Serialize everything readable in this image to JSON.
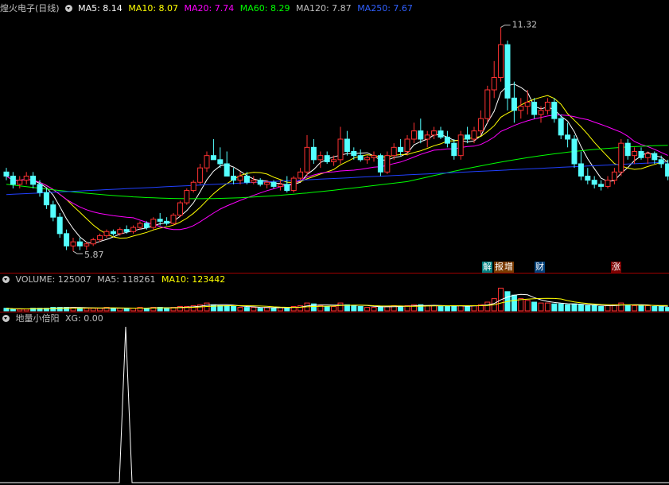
{
  "price_panel": {
    "title": "煌火电子(日线)",
    "legends": [
      {
        "label": "MA5: 8.14",
        "color": "#ffffff"
      },
      {
        "label": "MA10: 8.07",
        "color": "#ffff00"
      },
      {
        "label": "MA20: 7.74",
        "color": "#ff00ff"
      },
      {
        "label": "MA60: 8.29",
        "color": "#00ff00"
      },
      {
        "label": "MA120: 7.87",
        "color": "#c0c0c0"
      },
      {
        "label": "MA250: 7.67",
        "color": "#0000ff"
      }
    ],
    "high_label": "11.32",
    "low_label": "5.87",
    "events": [
      {
        "text": "解",
        "bg": "#00a0a0",
        "color": "#ffffff"
      },
      {
        "text": "报",
        "bg": "#a05000",
        "color": "#ffffff"
      },
      {
        "text": "增",
        "bg": "#a05000",
        "color": "#ffffff"
      },
      {
        "text": "财",
        "bg": "#0050a0",
        "color": "#ffffff"
      },
      {
        "text": "涨",
        "bg": "#a00000",
        "color": "#ffffff"
      }
    ]
  },
  "volume_panel": {
    "legends": [
      {
        "label": "VOLUME: 125007",
        "color": "#c0c0c0"
      },
      {
        "label": "MA5: 118261",
        "color": "#c0c0c0"
      },
      {
        "label": "MA10: 123442",
        "color": "#ffff00"
      }
    ]
  },
  "indicator_panel": {
    "legends": [
      {
        "label": "地量小倍阳",
        "color": "#c0c0c0"
      },
      {
        "label": "XG: 0.00",
        "color": "#c0c0c0"
      }
    ]
  },
  "chart_data": {
    "type": "candlestick",
    "candles": [
      [
        7.8,
        7.9,
        7.6,
        7.7
      ],
      [
        7.7,
        7.8,
        7.4,
        7.5
      ],
      [
        7.5,
        7.7,
        7.4,
        7.6
      ],
      [
        7.6,
        7.8,
        7.5,
        7.7
      ],
      [
        7.7,
        7.8,
        7.4,
        7.5
      ],
      [
        7.5,
        7.6,
        7.2,
        7.3
      ],
      [
        7.3,
        7.4,
        6.9,
        7.0
      ],
      [
        7.0,
        7.1,
        6.6,
        6.7
      ],
      [
        6.7,
        6.8,
        6.2,
        6.3
      ],
      [
        6.3,
        6.4,
        5.9,
        6.0
      ],
      [
        6.0,
        6.2,
        5.87,
        6.1
      ],
      [
        6.1,
        6.2,
        5.9,
        6.0
      ],
      [
        6.0,
        6.1,
        5.9,
        6.05
      ],
      [
        6.05,
        6.2,
        6.0,
        6.15
      ],
      [
        6.15,
        6.3,
        6.1,
        6.25
      ],
      [
        6.25,
        6.4,
        6.2,
        6.35
      ],
      [
        6.35,
        6.4,
        6.25,
        6.3
      ],
      [
        6.3,
        6.45,
        6.25,
        6.4
      ],
      [
        6.4,
        6.5,
        6.3,
        6.35
      ],
      [
        6.35,
        6.5,
        6.3,
        6.45
      ],
      [
        6.45,
        6.6,
        6.4,
        6.55
      ],
      [
        6.55,
        6.6,
        6.4,
        6.45
      ],
      [
        6.45,
        6.7,
        6.4,
        6.65
      ],
      [
        6.65,
        6.8,
        6.5,
        6.6
      ],
      [
        6.6,
        6.7,
        6.5,
        6.55
      ],
      [
        6.55,
        6.8,
        6.5,
        6.75
      ],
      [
        6.75,
        7.1,
        6.7,
        7.05
      ],
      [
        7.05,
        7.4,
        7.0,
        7.35
      ],
      [
        7.35,
        7.6,
        7.3,
        7.55
      ],
      [
        7.55,
        8.0,
        7.5,
        7.9
      ],
      [
        7.9,
        8.3,
        7.8,
        8.2
      ],
      [
        8.2,
        8.6,
        8.1,
        8.1
      ],
      [
        8.1,
        8.4,
        7.9,
        8.0
      ],
      [
        8.0,
        8.3,
        7.8,
        7.7
      ],
      [
        7.7,
        7.9,
        7.5,
        7.6
      ],
      [
        7.6,
        7.8,
        7.5,
        7.7
      ],
      [
        7.7,
        7.8,
        7.5,
        7.55
      ],
      [
        7.55,
        7.7,
        7.5,
        7.6
      ],
      [
        7.6,
        7.65,
        7.45,
        7.5
      ],
      [
        7.5,
        7.6,
        7.4,
        7.55
      ],
      [
        7.55,
        7.6,
        7.4,
        7.45
      ],
      [
        7.45,
        7.6,
        7.35,
        7.5
      ],
      [
        7.5,
        7.7,
        7.3,
        7.35
      ],
      [
        7.35,
        7.7,
        7.3,
        7.65
      ],
      [
        7.65,
        7.9,
        7.6,
        7.8
      ],
      [
        7.8,
        8.7,
        7.7,
        8.4
      ],
      [
        8.4,
        8.6,
        8.0,
        8.1
      ],
      [
        8.1,
        8.3,
        7.9,
        8.2
      ],
      [
        8.2,
        8.3,
        8.0,
        8.05
      ],
      [
        8.05,
        8.2,
        7.95,
        8.1
      ],
      [
        8.1,
        8.9,
        8.0,
        8.6
      ],
      [
        8.6,
        8.8,
        8.2,
        8.3
      ],
      [
        8.3,
        8.4,
        8.1,
        8.2
      ],
      [
        8.2,
        8.35,
        8.05,
        8.1
      ],
      [
        8.1,
        8.2,
        8.0,
        8.15
      ],
      [
        8.15,
        8.3,
        8.05,
        8.2
      ],
      [
        8.2,
        8.25,
        7.7,
        7.8
      ],
      [
        7.8,
        8.3,
        7.75,
        8.2
      ],
      [
        8.2,
        8.5,
        8.1,
        8.4
      ],
      [
        8.4,
        8.6,
        8.2,
        8.3
      ],
      [
        8.3,
        8.7,
        8.2,
        8.6
      ],
      [
        8.6,
        9.0,
        8.5,
        8.8
      ],
      [
        8.8,
        9.1,
        8.5,
        8.6
      ],
      [
        8.6,
        8.8,
        8.4,
        8.7
      ],
      [
        8.7,
        8.9,
        8.6,
        8.8
      ],
      [
        8.8,
        8.9,
        8.6,
        8.65
      ],
      [
        8.65,
        8.8,
        8.4,
        8.5
      ],
      [
        8.5,
        8.6,
        8.1,
        8.2
      ],
      [
        8.2,
        8.8,
        8.1,
        8.7
      ],
      [
        8.7,
        8.9,
        8.5,
        8.6
      ],
      [
        8.6,
        8.9,
        8.5,
        8.8
      ],
      [
        8.8,
        9.3,
        8.7,
        9.1
      ],
      [
        9.1,
        9.9,
        9.0,
        9.8
      ],
      [
        9.8,
        10.5,
        9.6,
        10.1
      ],
      [
        10.1,
        11.32,
        10.0,
        10.9
      ],
      [
        10.9,
        11.0,
        9.3,
        9.6
      ],
      [
        9.6,
        10.0,
        9.0,
        9.3
      ],
      [
        9.3,
        9.6,
        9.1,
        9.4
      ],
      [
        9.4,
        9.8,
        9.2,
        9.5
      ],
      [
        9.5,
        9.6,
        9.1,
        9.2
      ],
      [
        9.2,
        9.4,
        9.0,
        9.3
      ],
      [
        9.3,
        9.6,
        9.2,
        9.5
      ],
      [
        9.5,
        9.6,
        9.0,
        9.1
      ],
      [
        9.1,
        9.2,
        8.6,
        8.7
      ],
      [
        8.7,
        9.0,
        8.4,
        8.6
      ],
      [
        8.6,
        8.7,
        7.9,
        8.0
      ],
      [
        8.0,
        8.3,
        7.6,
        7.7
      ],
      [
        7.7,
        7.9,
        7.5,
        7.6
      ],
      [
        7.6,
        7.7,
        7.4,
        7.5
      ],
      [
        7.5,
        7.6,
        7.35,
        7.45
      ],
      [
        7.45,
        7.7,
        7.4,
        7.6
      ],
      [
        7.6,
        7.9,
        7.5,
        7.8
      ],
      [
        7.8,
        8.6,
        7.7,
        8.5
      ],
      [
        8.5,
        8.6,
        8.1,
        8.2
      ],
      [
        8.2,
        8.4,
        8.0,
        8.3
      ],
      [
        8.3,
        8.4,
        8.1,
        8.15
      ],
      [
        8.15,
        8.3,
        8.0,
        8.25
      ],
      [
        8.25,
        8.3,
        8.0,
        8.1
      ],
      [
        8.1,
        8.2,
        7.9,
        8.0
      ],
      [
        8.0,
        8.1,
        7.6,
        7.7
      ]
    ],
    "volume": [
      3,
      2,
      2,
      2,
      3,
      3,
      3,
      4,
      4,
      4,
      4,
      3,
      3,
      3,
      3,
      4,
      3,
      3,
      3,
      3,
      4,
      3,
      4,
      4,
      3,
      4,
      5,
      5,
      6,
      7,
      9,
      7,
      6,
      6,
      5,
      4,
      4,
      4,
      3,
      4,
      3,
      4,
      4,
      5,
      6,
      9,
      8,
      6,
      5,
      5,
      9,
      7,
      6,
      5,
      4,
      4,
      5,
      5,
      6,
      5,
      6,
      7,
      7,
      6,
      6,
      5,
      5,
      6,
      6,
      5,
      6,
      7,
      10,
      14,
      26,
      22,
      18,
      14,
      12,
      10,
      9,
      9,
      8,
      8,
      7,
      8,
      7,
      6,
      6,
      5,
      6,
      7,
      9,
      7,
      6,
      6,
      6,
      5,
      5,
      4
    ],
    "xg_signal_index": 26,
    "ylim": [
      5.6,
      11.6
    ]
  }
}
